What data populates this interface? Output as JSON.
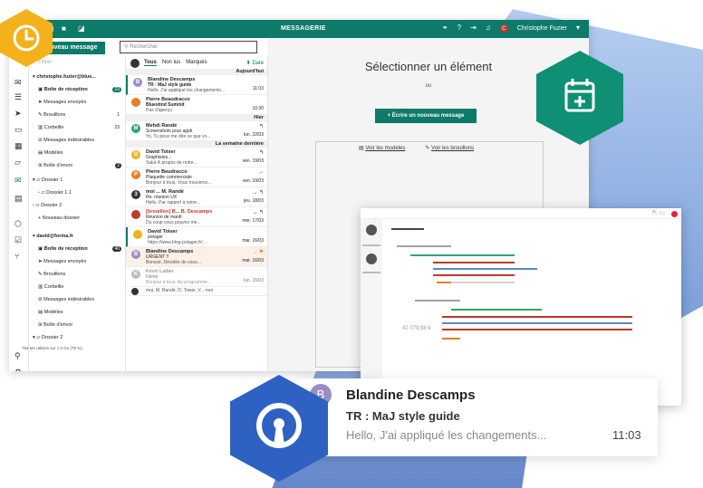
{
  "app": {
    "title": "MESSAGERIE",
    "user": "Christophe Fuzier"
  },
  "toolbar": {
    "new_message": "Nouveau message",
    "search_placeholder": "Rechercher",
    "filter": "Filtrer"
  },
  "folders": {
    "account1": "christophe.fuzier@blue...",
    "account1_items": [
      {
        "label": "Boîte de réception",
        "badge": "23"
      },
      {
        "label": "Messages envoyés",
        "badge": ""
      },
      {
        "label": "Brouillons",
        "badge": "1"
      },
      {
        "label": "Corbeille",
        "badge": "23"
      },
      {
        "label": "Messages indésirables",
        "badge": ""
      },
      {
        "label": "Modèles",
        "badge": ""
      },
      {
        "label": "Boîte d'envoi",
        "badge": "2"
      }
    ],
    "dossier1": "Dossier 1",
    "dossier11": "Dossier 1.1",
    "dossier2": "Dossier 2",
    "new_folder": "Nouveau dossier",
    "account2": "david@forma.fr",
    "account2_items": [
      {
        "label": "Boîte de réception",
        "badge": "40"
      },
      {
        "label": "Messages envoyés",
        "badge": ""
      },
      {
        "label": "Brouillons",
        "badge": ""
      },
      {
        "label": "Corbeille",
        "badge": ""
      },
      {
        "label": "Messages indésirables",
        "badge": ""
      },
      {
        "label": "Modèles",
        "badge": ""
      },
      {
        "label": "Boîte d'envoi",
        "badge": ""
      }
    ],
    "dossier2b": "Dossier 2",
    "quota": "794 Mo utilisés sur 1.0 Go (79 %)"
  },
  "tabs": {
    "all": "Tous",
    "unread": "Non lus",
    "marked": "Marqués",
    "date": "Date"
  },
  "separators": {
    "today": "Aujourd'hui",
    "yesterday": "Hier",
    "last_week": "La semaine dernière"
  },
  "messages": [
    {
      "initial": "B",
      "from": "Blandine Descamps",
      "subject": "TR : MaJ style guide",
      "preview": "Hello, J'ai appliqué les changements...",
      "time": "11:03",
      "color": "#9b8ec4"
    },
    {
      "initial": "",
      "from": "Pierre Beaudracco",
      "subject": "Bluestind Summit",
      "preview": "Pas d'aperçu",
      "time": "10:30",
      "color": "#e67e22"
    },
    {
      "initial": "M",
      "from": "Mehdi Randé",
      "subject": "Screenshots pour appli",
      "preview": "Yo, Tu peux me dire ce que vo...",
      "time": "lun. 22/03",
      "color": "#2ea56b"
    },
    {
      "initial": "D",
      "from": "David Toiser",
      "subject": "Graphistes...",
      "preview": "Salut À propos de notre...",
      "time": "ven. 19/03",
      "color": "#f3b21b"
    },
    {
      "initial": "P",
      "from": "Pierre Beudracco",
      "subject": "Plaquette commerciale",
      "preview": "Bonjour à tous, Vous trouverez...",
      "time": "ven. 19/03",
      "color": "#e67e22"
    },
    {
      "initial": "3",
      "from": "moi ... M. Randé",
      "subject": "Re: réunion UX",
      "preview": "Hello, Par rapport à notre...",
      "time": "jeu. 18/03",
      "color": "#333333"
    },
    {
      "initial": "",
      "from": "[brouillon] B... B. Descamps",
      "subject": "Réunion de mardi",
      "preview": "Du coup vous pouvez me...",
      "time": "mer. 17/03",
      "color": "#c0392b"
    },
    {
      "initial": "",
      "from": "David Toiser",
      "subject": "potager",
      "preview": "https://www.blog-potager.fr/...",
      "time": "mar. 16/03",
      "color": "#f3b21b"
    },
    {
      "initial": "B",
      "from": "Blandine Descamps",
      "subject": "URGENT !!",
      "preview": "Bonsoir, Décidée de vous...",
      "time": "mar. 16/03",
      "color": "#9b8ec4"
    },
    {
      "initial": "K",
      "from": "Kévin Ladier",
      "subject": "Démo",
      "preview": "Bonjour à tous, Au programme...",
      "time": "lun. 15/03",
      "color": "#bbbbbb"
    },
    {
      "initial": "",
      "from": "moi, M. Randé, D. Toiser, V... moi",
      "subject": "",
      "preview": "",
      "time": "",
      "color": "#333333"
    }
  ],
  "pane": {
    "heading": "Sélectionner un élément",
    "or": "ou",
    "write": "Écrire un nouveau message",
    "templates": "Voir les modèles",
    "drafts": "Voir les brouillons"
  },
  "preview_window": {
    "amount": "42 079,98 €"
  },
  "notification": {
    "initial": "B",
    "from": "Blandine Descamps",
    "subject": "TR : MaJ style guide",
    "preview": "Hello, J'ai appliqué les changements...",
    "time": "11:03"
  }
}
